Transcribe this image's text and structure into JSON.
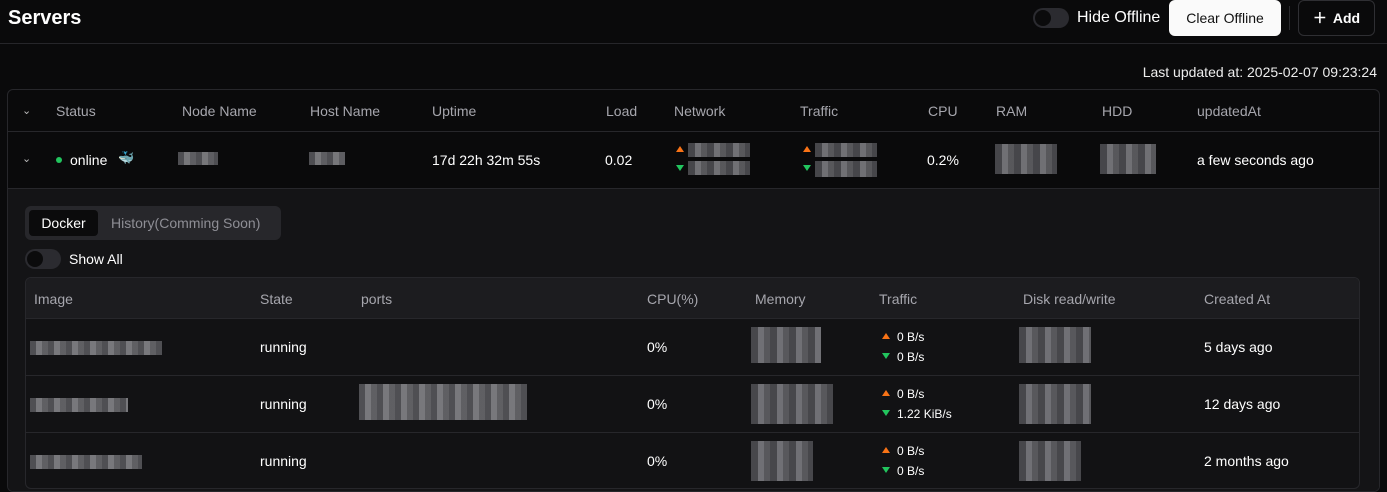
{
  "header": {
    "title": "Servers",
    "hide_offline_label": "Hide Offline",
    "clear_offline_label": "Clear Offline",
    "add_label": "Add",
    "add_icon": "plus-icon"
  },
  "last_updated": "Last updated at: 2025-02-07 09:23:24",
  "servers": {
    "columns": [
      "Status",
      "Node Name",
      "Host Name",
      "Uptime",
      "Load",
      "Network",
      "Traffic",
      "CPU",
      "RAM",
      "HDD",
      "updatedAt"
    ],
    "rows": [
      {
        "status": "online",
        "status_color": "#22c55e",
        "status_icon": "docker-icon",
        "uptime": "17d 22h 32m 55s",
        "load": "0.02",
        "cpu": "0.2%",
        "updated_at": "a few seconds ago"
      }
    ]
  },
  "details": {
    "tabs": [
      "Docker",
      "History(Comming Soon)"
    ],
    "show_all_label": "Show All",
    "docker": {
      "columns": [
        "Image",
        "State",
        "ports",
        "CPU(%)",
        "Memory",
        "Traffic",
        "Disk read/write",
        "Created At"
      ],
      "rows": [
        {
          "state": "running",
          "cpu": "0%",
          "traffic_up": "0 B/s",
          "traffic_down": "0 B/s",
          "created_at": "5 days ago"
        },
        {
          "state": "running",
          "cpu": "0%",
          "traffic_up": "0 B/s",
          "traffic_down": "1.22 KiB/s",
          "created_at": "12 days ago"
        },
        {
          "state": "running",
          "cpu": "0%",
          "traffic_up": "0 B/s",
          "traffic_down": "0 B/s",
          "created_at": "2 months ago"
        }
      ]
    }
  },
  "colors": {
    "accent_up": "#f97316",
    "accent_down": "#22c55e",
    "background": "#0a0a0b"
  }
}
